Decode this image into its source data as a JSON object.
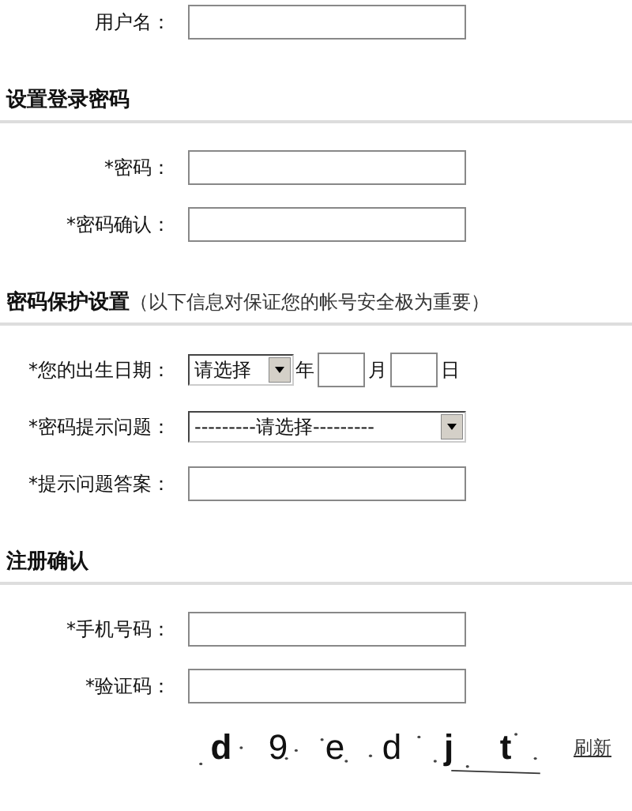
{
  "top_row": {
    "label": "用户名："
  },
  "sections": [
    {
      "title": "设置登录密码",
      "rows": [
        {
          "kind": "input",
          "label": "*密码："
        },
        {
          "kind": "input",
          "label": "*密码确认："
        }
      ]
    },
    {
      "title": "密码保护设置",
      "note": "（以下信息对保证您的帐号安全极为重要）",
      "rows": [
        {
          "kind": "date",
          "label": "*您的出生日期：",
          "select": "请选择",
          "units": [
            "年",
            "月",
            "日"
          ]
        },
        {
          "kind": "select",
          "label": "*密码提示问题：",
          "select": "---------请选择---------"
        },
        {
          "kind": "input",
          "label": "*提示问题答案："
        }
      ]
    },
    {
      "title": "注册确认",
      "rows": [
        {
          "kind": "input",
          "label": "*手机号码："
        },
        {
          "kind": "input",
          "label": "*验证码："
        }
      ]
    }
  ],
  "captcha": {
    "chars": [
      {
        "ch": "d",
        "bold": true
      },
      {
        "ch": "9",
        "bold": false
      },
      {
        "ch": "e",
        "bold": false
      },
      {
        "ch": "d",
        "bold": false
      },
      {
        "ch": "j",
        "bold": true
      },
      {
        "ch": "t",
        "bold": true
      }
    ],
    "refresh": "刷新"
  }
}
